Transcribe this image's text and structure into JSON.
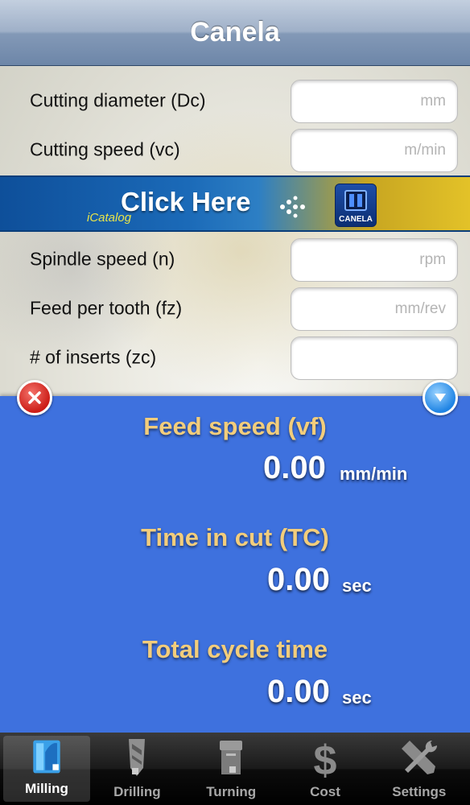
{
  "nav": {
    "title": "Canela"
  },
  "form": {
    "cutting_diameter": {
      "label": "Cutting diameter (Dc)",
      "placeholder": "mm",
      "value": ""
    },
    "cutting_speed": {
      "label": "Cutting speed (vc)",
      "placeholder": "m/min",
      "value": ""
    },
    "spindle_speed": {
      "label": "Spindle speed (n)",
      "placeholder": "rpm",
      "value": ""
    },
    "feed_per_tooth": {
      "label": "Feed per tooth (fz)",
      "placeholder": "mm/rev",
      "value": ""
    },
    "inserts": {
      "label": "# of inserts (zc)",
      "placeholder": "",
      "value": ""
    }
  },
  "banner": {
    "text": "Click Here",
    "sub": "iCatalog",
    "logo_text": "CANELA"
  },
  "results": {
    "feed_speed": {
      "title": "Feed speed (vf)",
      "value": "0.00",
      "unit": "mm/min"
    },
    "time_in_cut": {
      "title": "Time in cut (TC)",
      "value": "0.00",
      "unit": "sec"
    },
    "total_cycle": {
      "title": "Total cycle time",
      "value": "0.00",
      "unit": "sec"
    },
    "close_icon": "close-x-icon",
    "collapse_icon": "chevron-down-icon"
  },
  "tabs": [
    {
      "label": "Milling",
      "icon": "milling-tool-icon",
      "active": true
    },
    {
      "label": "Drilling",
      "icon": "drill-bit-icon",
      "active": false
    },
    {
      "label": "Turning",
      "icon": "turning-insert-icon",
      "active": false
    },
    {
      "label": "Cost",
      "icon": "dollar-icon",
      "active": false
    },
    {
      "label": "Settings",
      "icon": "tools-icon",
      "active": false
    }
  ],
  "colors": {
    "result_panel": "#3e71de",
    "result_title": "#f2cd7c",
    "close_button": "#cc1d17",
    "collapse_button": "#1f84e4"
  }
}
